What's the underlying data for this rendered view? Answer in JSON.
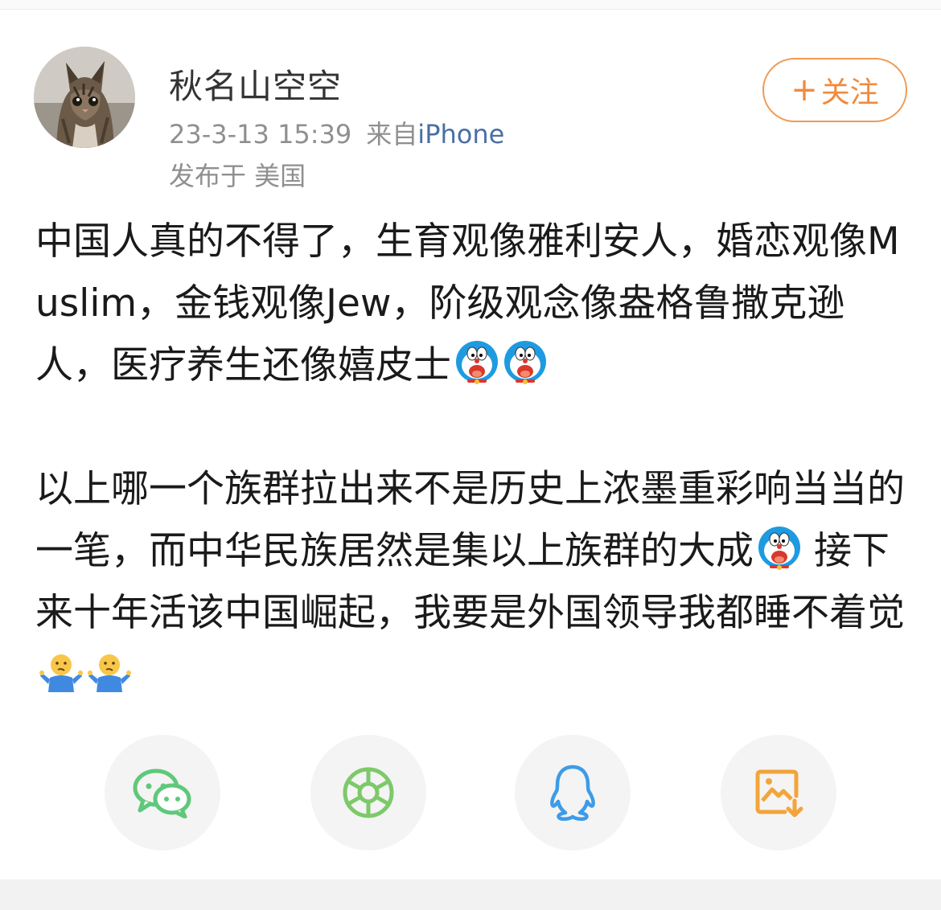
{
  "post": {
    "username": "秋名山空空",
    "timestamp": "23-3-13 15:39",
    "source_prefix": "来自",
    "source": "iPhone",
    "location": "发布于 美国",
    "follow_label": "关注",
    "follow_plus": "+"
  },
  "body": {
    "paragraph1": "中国人真的不得了，生育观像雅利安人，婚恋观像Muslim，金钱观像Jew，阶级观念像盎格鲁撒克逊人，医疗养生还像嬉皮士",
    "paragraph1_emojis": [
      "doraemon-emoji",
      "doraemon-emoji"
    ],
    "paragraph2_a": "以上哪一个族群拉出来不是历史上浓墨重彩响当当的一笔，而中华民族居然是集以上族群的大成",
    "paragraph2_b": " 接下来十年活该中国崛起，我要是外国领导我都睡不着觉",
    "paragraph2_emojis": [
      "doraemon-emoji",
      "shrug-emoji",
      "shrug-emoji"
    ]
  },
  "share": [
    {
      "icon": "wechat-icon"
    },
    {
      "icon": "moments-icon"
    },
    {
      "icon": "qq-icon"
    },
    {
      "icon": "save-image-icon"
    }
  ],
  "colors": {
    "accent": "#f08a3c",
    "link": "#4a6fa5",
    "meta": "#8f8f8f",
    "wechat": "#5fc87a",
    "moments": "#7dc96a",
    "qq": "#3d9be8",
    "save": "#f3a43a"
  }
}
